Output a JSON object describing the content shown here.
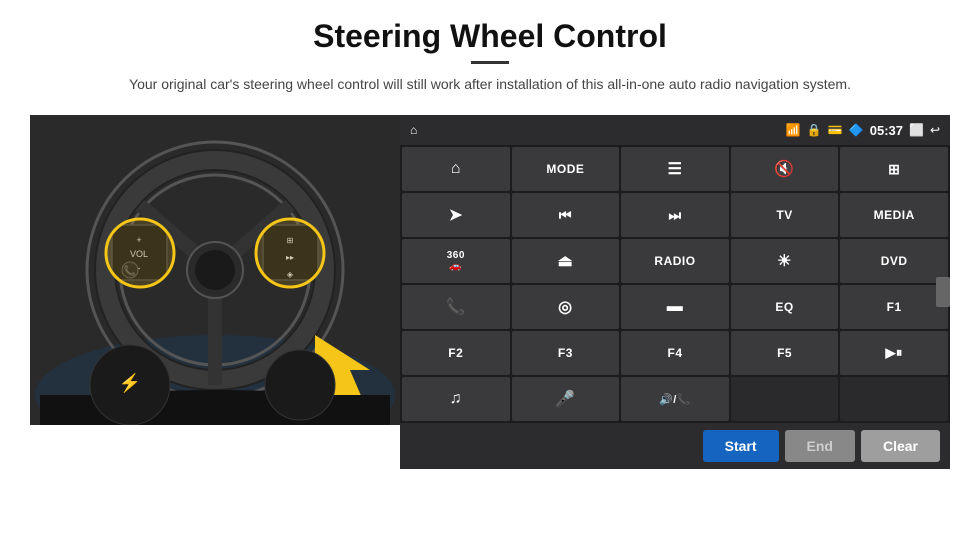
{
  "header": {
    "title": "Steering Wheel Control",
    "subtitle": "Your original car's steering wheel control will still work after installation of this all-in-one auto radio navigation system."
  },
  "status_bar": {
    "time": "05:37"
  },
  "buttons": [
    {
      "id": "nav",
      "label": "",
      "icon": "⌂",
      "type": "icon"
    },
    {
      "id": "mode",
      "label": "MODE",
      "icon": "",
      "type": "text"
    },
    {
      "id": "list",
      "label": "",
      "icon": "☰",
      "type": "icon"
    },
    {
      "id": "mute",
      "label": "",
      "icon": "🔇",
      "type": "icon"
    },
    {
      "id": "apps",
      "label": "",
      "icon": "⊞",
      "type": "icon"
    },
    {
      "id": "send",
      "label": "",
      "icon": "➤",
      "type": "icon"
    },
    {
      "id": "prev",
      "label": "",
      "icon": "⏮",
      "type": "icon"
    },
    {
      "id": "next",
      "label": "",
      "icon": "⏭",
      "type": "icon"
    },
    {
      "id": "tv",
      "label": "TV",
      "icon": "",
      "type": "text"
    },
    {
      "id": "media",
      "label": "MEDIA",
      "icon": "",
      "type": "text"
    },
    {
      "id": "cam360",
      "label": "360",
      "icon": "🚗",
      "type": "icon"
    },
    {
      "id": "eject",
      "label": "",
      "icon": "⏏",
      "type": "icon"
    },
    {
      "id": "radio",
      "label": "RADIO",
      "icon": "",
      "type": "text"
    },
    {
      "id": "brightness",
      "label": "",
      "icon": "☀",
      "type": "icon"
    },
    {
      "id": "dvd",
      "label": "DVD",
      "icon": "",
      "type": "text"
    },
    {
      "id": "phone",
      "label": "",
      "icon": "📞",
      "type": "icon"
    },
    {
      "id": "navi",
      "label": "",
      "icon": "◎",
      "type": "icon"
    },
    {
      "id": "screen",
      "label": "",
      "icon": "▬",
      "type": "icon"
    },
    {
      "id": "eq",
      "label": "EQ",
      "icon": "",
      "type": "text"
    },
    {
      "id": "f1",
      "label": "F1",
      "icon": "",
      "type": "text"
    },
    {
      "id": "f2",
      "label": "F2",
      "icon": "",
      "type": "text"
    },
    {
      "id": "f3",
      "label": "F3",
      "icon": "",
      "type": "text"
    },
    {
      "id": "f4",
      "label": "F4",
      "icon": "",
      "type": "text"
    },
    {
      "id": "f5",
      "label": "F5",
      "icon": "",
      "type": "text"
    },
    {
      "id": "play-pause",
      "label": "",
      "icon": "▶⏸",
      "type": "icon"
    },
    {
      "id": "music",
      "label": "",
      "icon": "♫",
      "type": "icon"
    },
    {
      "id": "mic",
      "label": "",
      "icon": "🎤",
      "type": "icon"
    },
    {
      "id": "vol-phone",
      "label": "",
      "icon": "🔊",
      "type": "icon"
    },
    {
      "id": "empty1",
      "label": "",
      "icon": "",
      "type": "empty"
    },
    {
      "id": "empty2",
      "label": "",
      "icon": "",
      "type": "empty"
    }
  ],
  "bottom_bar": {
    "start_label": "Start",
    "end_label": "End",
    "clear_label": "Clear"
  }
}
